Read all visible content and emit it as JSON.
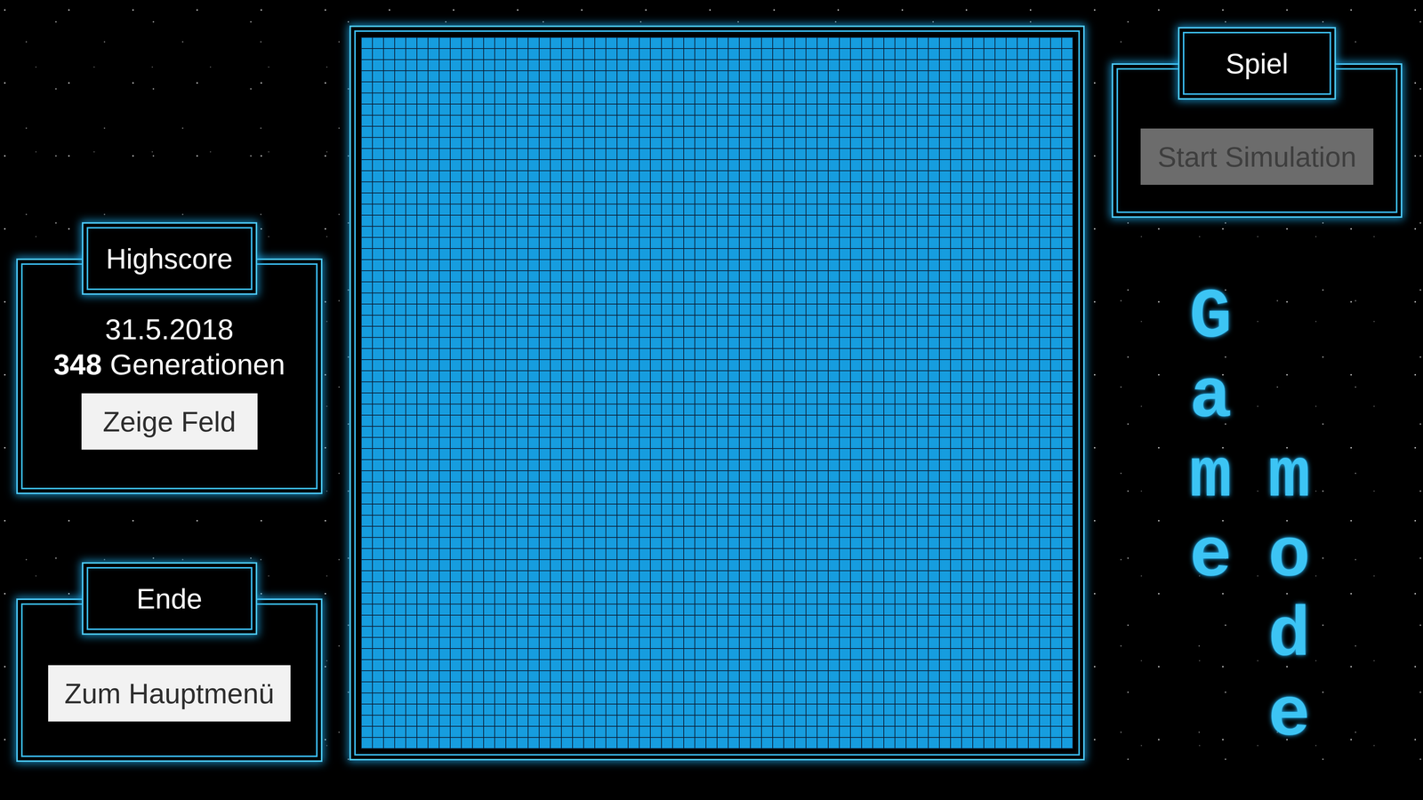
{
  "highscore": {
    "title": "Highscore",
    "date": "31.5.2018",
    "generations": "348",
    "generations_label": "Generationen",
    "button": "Zeige Feld"
  },
  "end": {
    "title": "Ende",
    "button": "Zum Hauptmenü"
  },
  "game": {
    "title": "Spiel",
    "button": {
      "label": "Start Simulation",
      "disabled": true
    }
  },
  "board": {
    "rows": 64,
    "columns": 64
  },
  "logo": [
    "Game",
    "mode"
  ]
}
